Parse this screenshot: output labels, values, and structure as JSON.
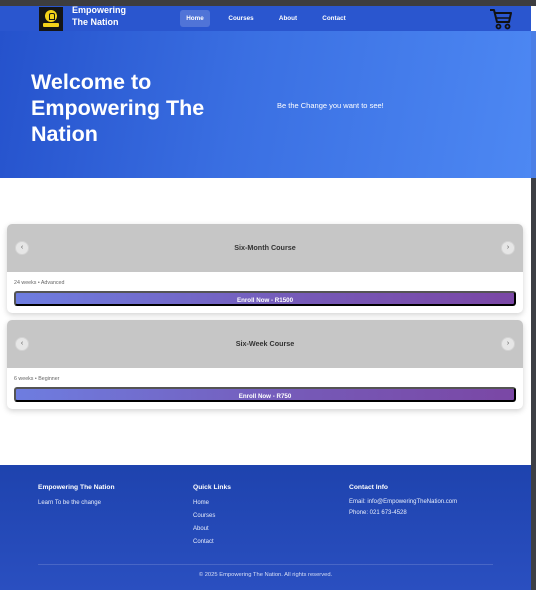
{
  "brand": {
    "name": "Empowering The Nation"
  },
  "nav": {
    "links": [
      {
        "label": "Home",
        "active": true
      },
      {
        "label": "Courses",
        "active": false
      },
      {
        "label": "About",
        "active": false
      },
      {
        "label": "Contact",
        "active": false
      }
    ],
    "cart_icon": "shopping-cart-icon"
  },
  "hero": {
    "title": "Welcome to Empowering The Nation",
    "tagline": "Be the Change you want to see!"
  },
  "courses": [
    {
      "title": "Six-Month Course",
      "meta": "24 weeks • Advanced",
      "enroll_label": "Enroll Now - R1500",
      "prev_icon": "chevron-left-icon",
      "next_icon": "chevron-right-icon"
    },
    {
      "title": "Six-Week Course",
      "meta": "6 weeks • Beginner",
      "enroll_label": "Enroll Now - R750",
      "prev_icon": "chevron-left-icon",
      "next_icon": "chevron-right-icon"
    }
  ],
  "footer": {
    "about": {
      "heading": "Empowering The Nation",
      "text": "Learn To be the change"
    },
    "quick_links": {
      "heading": "Quick Links",
      "items": [
        "Home",
        "Courses",
        "About",
        "Contact"
      ]
    },
    "contact": {
      "heading": "Contact Info",
      "email": "Email: info@EmpoweringTheNation.com",
      "phone": "Phone: 021 673-4528"
    },
    "copyright": "© 2025 Empowering The Nation. All rights reserved."
  },
  "colors": {
    "nav_bg": "#2a56cf",
    "hero_start": "#2552cc",
    "hero_end": "#4d88f3",
    "button_start": "#6e7de0",
    "button_end": "#7a47a5",
    "footer_bg": "#1e43ae",
    "logo_yellow": "#f3d21a"
  }
}
